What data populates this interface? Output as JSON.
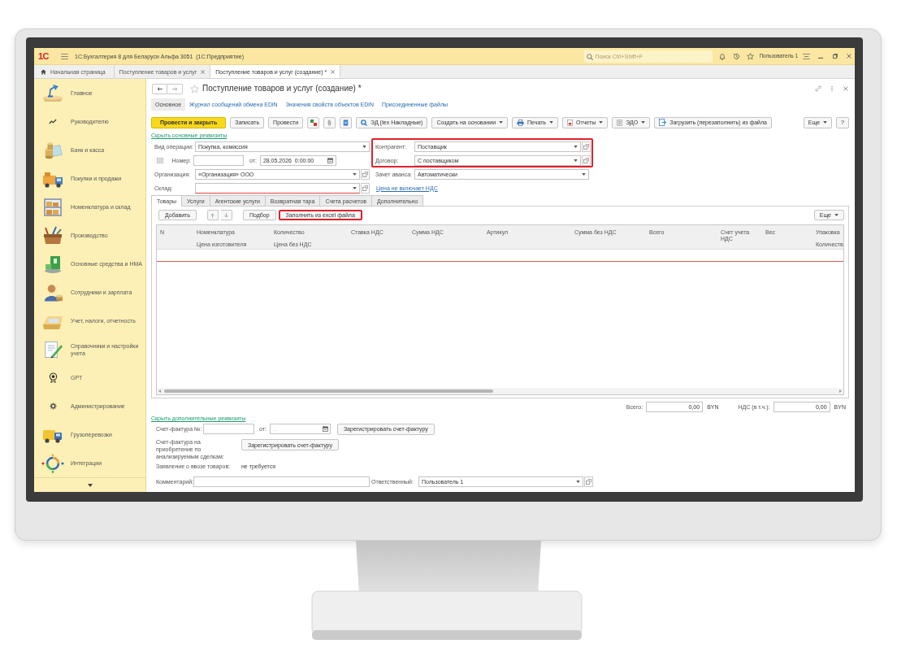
{
  "app": {
    "logo": "1С",
    "title": "1С:Бухгалтерия 8 для Беларуси Альфа 3051  (1С:Предприятие)",
    "search": {
      "placeholder": "Поиск Ctrl+Shift+F"
    },
    "user": "Пользователь 1"
  },
  "open_tabs": [
    {
      "kind": "home",
      "label": "Начальная страница",
      "selected": false
    },
    {
      "kind": "document",
      "label": "Поступление товаров и услуг",
      "selected": false
    },
    {
      "kind": "document",
      "label": "Поступление товаров и услуг (создание) *",
      "selected": true
    }
  ],
  "sidebar": {
    "items": [
      {
        "label": "Главное"
      },
      {
        "label": "Руководителю"
      },
      {
        "label": "Банк и касса"
      },
      {
        "label": "Покупки и продажи"
      },
      {
        "label": "Номенклатура и склад"
      },
      {
        "label": "Производство"
      },
      {
        "label": "Основные средства и НМА"
      },
      {
        "label": "Сотрудники и зарплата"
      },
      {
        "label": "Учет, налоги, отчетность"
      },
      {
        "label": "Справочники и настройки учета"
      },
      {
        "label": "GPT"
      },
      {
        "label": "Администрирование"
      },
      {
        "label": "Грузоперевозки"
      },
      {
        "label": "Интеграции"
      }
    ]
  },
  "form": {
    "title": "Поступление товаров и услуг (создание) *",
    "sections": [
      {
        "label": "Основное",
        "selected": true
      },
      {
        "label": "Журнал сообщений обмена EDiN",
        "selected": false
      },
      {
        "label": "Значения свойств объектов EDiN",
        "selected": false
      },
      {
        "label": "Присоединенные файлы",
        "selected": false
      }
    ],
    "toolbar": [
      {
        "kind": "primary",
        "label": "Провести и закрыть"
      },
      {
        "kind": "plain",
        "label": "Записать"
      },
      {
        "kind": "plain",
        "label": "Провести"
      },
      {
        "kind": "icon"
      },
      {
        "kind": "icon"
      },
      {
        "kind": "icon"
      },
      {
        "kind": "icon_label",
        "label": "ЭД (Iex Накладные)"
      },
      {
        "kind": "menu",
        "label": "Создать на основании"
      },
      {
        "kind": "icon_menu",
        "label": "Печать"
      },
      {
        "kind": "icon_menu",
        "label": "Отчеты"
      },
      {
        "kind": "icon_menu",
        "label": "ЭДО"
      },
      {
        "kind": "icon_label",
        "label": "Загрузить (перезаполнить) из файла"
      }
    ],
    "toolbar_right": [
      {
        "kind": "menu",
        "label": "Еще"
      },
      {
        "kind": "plain",
        "label": "?"
      }
    ],
    "hide_main_link": "Скрыть основные реквизиты",
    "left_fields": [
      {
        "kind": "select",
        "label": "Вид операции:",
        "value": "Покупка, комиссия",
        "required": false
      },
      {
        "kind": "number_date",
        "label": "Номер:",
        "date": {
          "label": "от:",
          "value": "28.05.2026  0:00:00"
        },
        "required": false
      },
      {
        "kind": "reference",
        "label": "Организация:",
        "value": "«Организация» ООО",
        "required": false
      },
      {
        "kind": "reference",
        "label": "Склад:",
        "required": true
      }
    ],
    "party": {
      "highlighted": true,
      "fields": [
        {
          "label": "Контрагент:",
          "value": "Поставщик"
        },
        {
          "label": "Договор:",
          "value": "С поставщиком"
        }
      ]
    },
    "advance": {
      "label": "Зачет аванса:",
      "value": "Автоматически"
    },
    "price_link": "Цена не включает НДС",
    "tabs": [
      {
        "label": "Товары",
        "selected": true
      },
      {
        "label": "Услуги",
        "selected": false
      },
      {
        "label": "Агентские услуги",
        "selected": false
      },
      {
        "label": "Возвратная тара",
        "selected": false
      },
      {
        "label": "Счета расчетов",
        "selected": false
      },
      {
        "label": "Дополнительно",
        "selected": false
      }
    ],
    "table_toolbar": [
      {
        "kind": "button",
        "label": "Добавить",
        "highlighted": false
      },
      {
        "kind": "move_up",
        "highlighted": false
      },
      {
        "kind": "move_down",
        "highlighted": false
      },
      {
        "kind": "button",
        "label": "Подбор",
        "highlighted": false
      },
      {
        "kind": "button",
        "label": "Заполнить из excel файла",
        "highlighted": true
      }
    ],
    "table_toolbar_right": {
      "label": "Еще"
    },
    "columns": [
      {
        "title": "N"
      },
      {
        "title": "Номенклатура",
        "subtitle": "Цена изготовителя"
      },
      {
        "title": "Количество",
        "subtitle": "Цена без НДС"
      },
      {
        "title": "Ставка НДС"
      },
      {
        "title": "Сумма НДС"
      },
      {
        "title": "Артикул"
      },
      {
        "title": "Сумма без НДС"
      },
      {
        "title": "Всего"
      },
      {
        "title": "Счет учета НДС"
      },
      {
        "title": "Вес"
      },
      {
        "title": "Упаковка",
        "subtitle": "Количеств"
      }
    ],
    "totals": [
      {
        "label": "Всего:",
        "value": "0,00",
        "currency": "BYN"
      },
      {
        "label": "НДС (в т.ч.):",
        "value": "0,00",
        "currency": "BYN"
      }
    ],
    "hide_extra_link": "Скрыть дополнительные реквизиты",
    "invoice": {
      "label": "Счет-фактура №:",
      "date": {
        "label": "от:",
        "placeholder": ". ."
      },
      "button": "Зарегистрировать счет-фактуру"
    },
    "analyzed_invoice": {
      "label": "Счет-фактура на приобретение по анализируемым сделкам:",
      "button": "Зарегистрировать счет-фактуру"
    },
    "import_statement": {
      "label": "Заявление о ввозе товаров:",
      "value": "не требуется"
    },
    "comment": {
      "label": "Комментарий:"
    },
    "responsible": {
      "label": "Ответственный:",
      "value": "Пользователь 1"
    }
  }
}
